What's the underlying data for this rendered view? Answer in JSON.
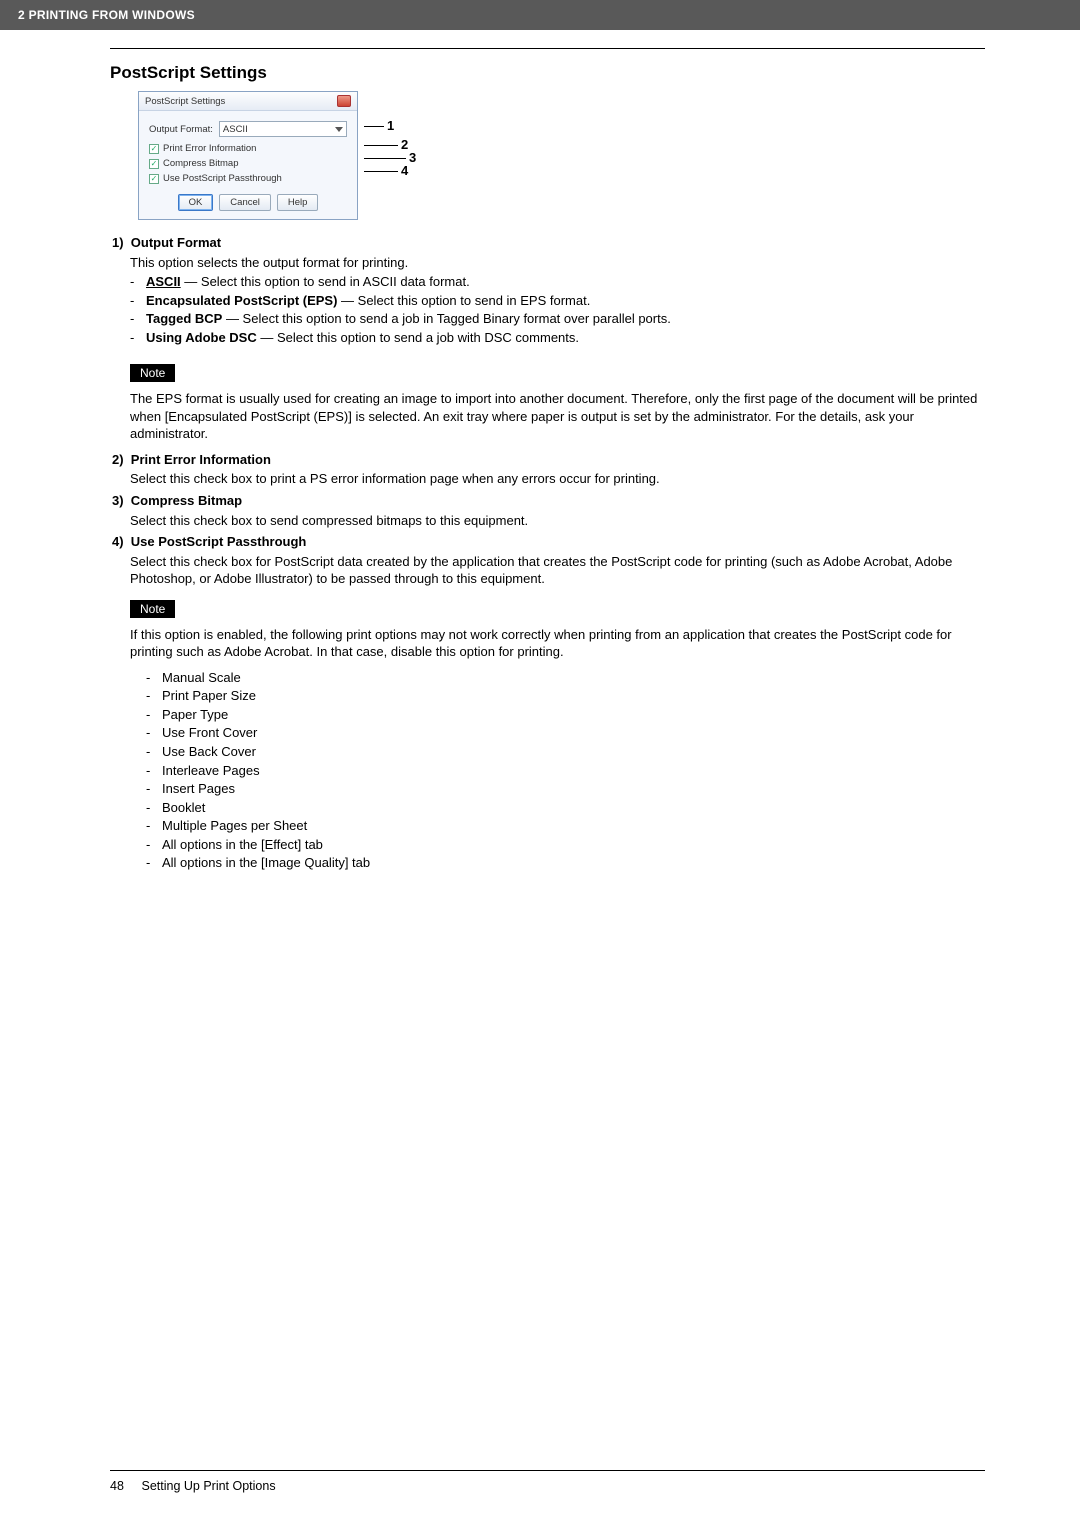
{
  "header": {
    "chapter": "2 PRINTING FROM WINDOWS"
  },
  "section_title": "PostScript Settings",
  "dialog": {
    "title": "PostScript Settings",
    "output_label": "Output Format:",
    "output_value": "ASCII",
    "opt_print_error": "Print Error Information",
    "opt_compress": "Compress Bitmap",
    "opt_passthrough": "Use PostScript Passthrough",
    "btn_ok": "OK",
    "btn_cancel": "Cancel",
    "btn_help": "Help"
  },
  "annot": {
    "n1": "1",
    "n2": "2",
    "n3": "3",
    "n4": "4"
  },
  "items": {
    "i1": {
      "num": "1)",
      "title": "Output Format",
      "desc": "This option selects the output format for printing.",
      "opts": {
        "ascii_label": "ASCII",
        "ascii_text": " — Select this option to send in ASCII data format.",
        "eps_label": "Encapsulated PostScript (EPS)",
        "eps_text": " — Select this option to send in EPS format.",
        "bcp_label": "Tagged BCP",
        "bcp_text": " — Select this option to send a job in Tagged Binary format over parallel ports.",
        "dsc_label": "Using Adobe DSC",
        "dsc_text": " — Select this option to send a job with DSC comments."
      },
      "note_label": "Note",
      "note_text": "The EPS format is usually used for creating an image to import into another document. Therefore, only the first page of the document will be printed when [Encapsulated PostScript (EPS)] is selected. An exit tray where paper is output is set by the administrator. For the details, ask your administrator."
    },
    "i2": {
      "num": "2)",
      "title": "Print Error Information",
      "desc": "Select this check box to print a PS error information page when any errors occur for printing."
    },
    "i3": {
      "num": "3)",
      "title": "Compress Bitmap",
      "desc": "Select this check box to send compressed bitmaps to this equipment."
    },
    "i4": {
      "num": "4)",
      "title": "Use PostScript Passthrough",
      "desc": "Select this check box for PostScript data created by the application that creates the PostScript code for printing (such as Adobe Acrobat, Adobe Photoshop, or Adobe Illustrator) to be passed through to this equipment.",
      "note_label": "Note",
      "note_intro": "If this option is enabled, the following print options may not work correctly when printing from an application that creates the PostScript code for printing such as Adobe Acrobat. In that case, disable this option for printing.",
      "bullets": {
        "b1": "Manual Scale",
        "b2": "Print Paper Size",
        "b3": "Paper Type",
        "b4": "Use Front Cover",
        "b5": "Use Back Cover",
        "b6": "Interleave Pages",
        "b7": "Insert Pages",
        "b8": "Booklet",
        "b9": "Multiple Pages per Sheet",
        "b10": "All options in the [Effect] tab",
        "b11": "All options in the [Image Quality] tab"
      }
    }
  },
  "footer": {
    "page": "48",
    "title": "Setting Up Print Options"
  }
}
